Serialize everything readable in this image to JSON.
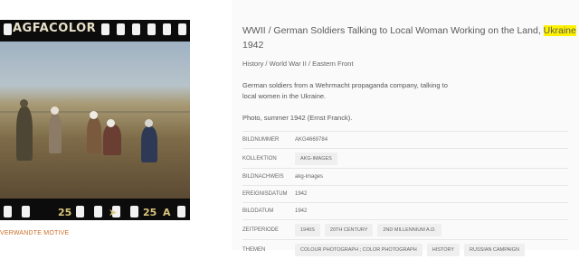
{
  "film": {
    "brand": "AGFACOLOR",
    "frame_left": "25",
    "frame_right": "25",
    "frame_letter": "A",
    "frame_icon": "arrow-right-icon"
  },
  "related_label": "VERWANDTE MOTIVE",
  "title_main": "WWII / German Soldiers Talking to Local Woman Working on the Land,",
  "title_highlight": "Ukraine",
  "title_year": "1942",
  "breadcrumb": "History / World War II / Eastern Front",
  "description": "German soldiers from a Wehrmacht propaganda company, talking to local women in the Ukraine.",
  "credit": "Photo, summer 1942 (Ernst Franck).",
  "meta": {
    "bildnummer_label": "BILDNUMMER",
    "bildnummer_value": "AKG4669784",
    "kollektion_label": "KOLLEKTION",
    "kollektion_value": "AKG-IMAGES",
    "bildnachweis_label": "BILDNACHWEIS",
    "bildnachweis_value": "akg-images",
    "ereignisdatum_label": "EREIGNISDATUM",
    "ereignisdatum_value": "1942",
    "bilddatum_label": "BILDDATUM",
    "bilddatum_value": "1942",
    "zeitperiode_label": "ZEITPERIODE",
    "zeitperiode_tags": [
      "1940S",
      "20TH CENTURY",
      "2ND MILLENNIUM A.D."
    ],
    "themen_label": "THEMEN",
    "themen_tags": [
      "COLOUR PHOTOGRAPH ; COLOR PHOTOGRAPH",
      "HISTORY",
      "RUSSIAN CAMPAIGN"
    ]
  },
  "colors": {
    "highlight": "#fff200",
    "related_link": "#c96e2a",
    "film": "#0c0c0c"
  }
}
